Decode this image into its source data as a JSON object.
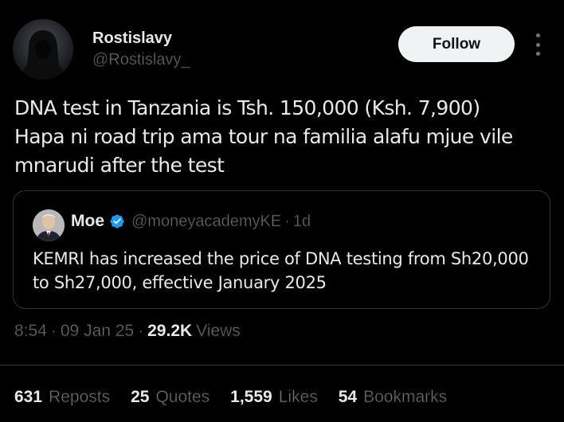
{
  "author": {
    "display_name": "Rostislavy",
    "handle": "@Rostislavy_",
    "avatar_icon": "hooded-figure-avatar"
  },
  "follow_label": "Follow",
  "more_icon": "more-vertical-icon",
  "tweet": {
    "lines": [
      "DNA test in Tanzania is Tsh. 150,000 (Ksh. 7,900)",
      "Hapa ni road trip ama tour na familia alafu mjue vile",
      "mnarudi after the test"
    ]
  },
  "quote": {
    "name": "Moe",
    "verified_icon": "verified-badge-icon",
    "verified_color": "#1d9bf0",
    "handle": "@moneyacademyKE",
    "dot": "·",
    "time": "1d",
    "lines": [
      "KEMRI has increased the price of DNA testing from Sh20,000",
      "to Sh27,000, effective January 2025"
    ]
  },
  "meta": {
    "time": "8:54",
    "date": "09 Jan 25",
    "sep": "·",
    "views_count": "29.2K",
    "views_label": "Views"
  },
  "stats": [
    {
      "count": "631",
      "label": "Reposts"
    },
    {
      "count": "25",
      "label": "Quotes"
    },
    {
      "count": "1,559",
      "label": "Likes"
    },
    {
      "count": "54",
      "label": "Bookmarks"
    }
  ],
  "colors": {
    "background": "#000000",
    "text": "#e7e9ea",
    "secondary": "#71767b",
    "border": "#2f3336",
    "follow_bg": "#eff3f4"
  }
}
